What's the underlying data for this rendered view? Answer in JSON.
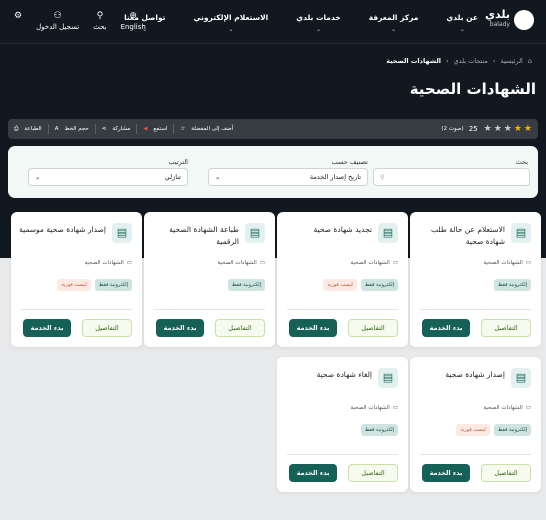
{
  "nav": {
    "logo_ar": "بلدي",
    "logo_en": "balady",
    "menu": [
      "عن بلدي",
      "مركز المعرفة",
      "خدمات بلدي",
      "الاستعلام الإلكتروني",
      "تواصل معنا"
    ],
    "language": "English",
    "search": "بحث",
    "login": "تسجيل الدخول"
  },
  "breadcrumb": [
    "الرئيسية",
    "منتجات بلدي",
    "الشهادات الصحية"
  ],
  "page_title": "الشهادات الصحية",
  "rating": {
    "stars_filled": 2,
    "stars_total": 5,
    "score": "25",
    "votes": "(2 صوت)"
  },
  "actions": {
    "favorite": "أضف إلى المفضلة",
    "listen": "استمع",
    "share": "مشاركة",
    "font_size": "حجم الخط",
    "print": "الطباعة"
  },
  "filter": {
    "search_label": "بحث",
    "search_value": "",
    "classify_label": "تصنيف حسب",
    "classify_value": "تاريخ إصدار الخدمة",
    "sort_label": "الترتيب",
    "sort_value": "تنازلي"
  },
  "cards": [
    {
      "title": "الاستعلام عن حالة طلب شهادة صحية",
      "category": "الشهادات الصحية",
      "tags": [
        "إلكترونية فقط"
      ],
      "details": "التفاصيل",
      "start": "بدء الخدمة",
      "icon": "clipboard-icon"
    },
    {
      "title": "تجديد شهادة صحية",
      "category": "الشهادات الصحية",
      "tags": [
        "إلكترونية فقط",
        "ليست فورية"
      ],
      "details": "التفاصيل",
      "start": "بدء الخدمة",
      "icon": "certificate-icon"
    },
    {
      "title": "طباعة الشهادة الصحية الرقمية",
      "category": "الشهادات الصحية",
      "tags": [
        "إلكترونية فقط"
      ],
      "details": "التفاصيل",
      "start": "بدء الخدمة",
      "icon": "printer-icon"
    },
    {
      "title": "إصدار شهادة صحية موسمية",
      "category": "الشهادات الصحية",
      "tags": [
        "إلكترونية فقط",
        "ليست فورية"
      ],
      "details": "التفاصيل",
      "start": "بدء الخدمة",
      "icon": "clipboard-icon"
    },
    {
      "title": "إصدار شهادة صحية",
      "category": "الشهادات الصحية",
      "tags": [
        "إلكترونية فقط",
        "ليست فورية"
      ],
      "details": "التفاصيل",
      "start": "بدء الخدمة",
      "icon": "certificate-icon"
    },
    {
      "title": "إلغاء شهادة صحية",
      "category": "الشهادات الصحية",
      "tags": [
        "إلكترونية فقط"
      ],
      "details": "التفاصيل",
      "start": "بدء الخدمة",
      "icon": "certificate-icon"
    }
  ]
}
